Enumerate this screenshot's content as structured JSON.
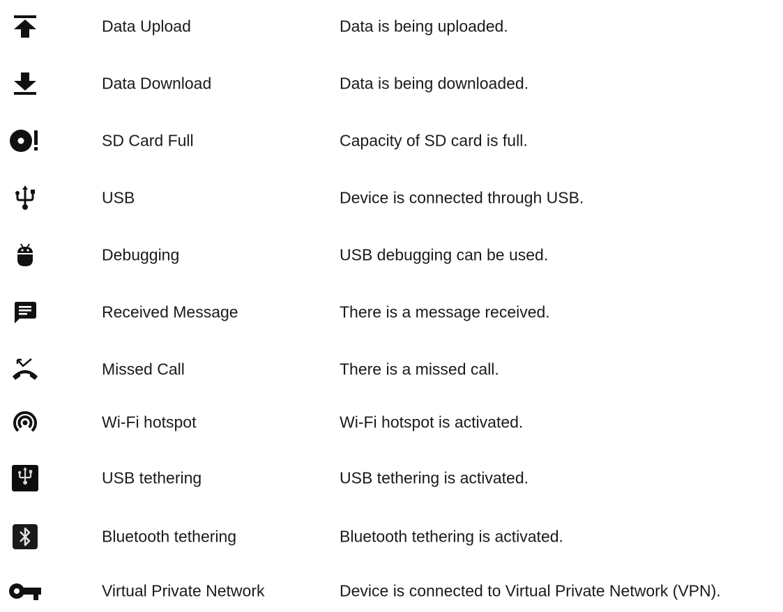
{
  "rows": [
    {
      "icon": "data-upload-icon",
      "name": "Data Upload",
      "description": "Data is being uploaded."
    },
    {
      "icon": "data-download-icon",
      "name": "Data Download",
      "description": "Data is being downloaded."
    },
    {
      "icon": "sd-card-full-icon",
      "name": "SD Card Full",
      "description": "Capacity of SD card is full."
    },
    {
      "icon": "usb-icon",
      "name": "USB",
      "description": "Device is connected through USB."
    },
    {
      "icon": "debugging-icon",
      "name": "Debugging",
      "description": "USB debugging can be used."
    },
    {
      "icon": "message-icon",
      "name": "Received Message",
      "description": "There is a message received."
    },
    {
      "icon": "missed-call-icon",
      "name": "Missed Call",
      "description": "There is a missed call."
    },
    {
      "icon": "wifi-hotspot-icon",
      "name": "Wi-Fi hotspot",
      "description": "Wi-Fi hotspot is activated."
    },
    {
      "icon": "usb-tethering-icon",
      "name": "USB tethering",
      "description": "USB tethering is activated."
    },
    {
      "icon": "bluetooth-tethering-icon",
      "name": "Bluetooth tethering",
      "description": "Bluetooth tethering is activated."
    },
    {
      "icon": "vpn-key-icon",
      "name": "Virtual Private Network",
      "description": "Device is connected to Virtual Private Network (VPN)."
    }
  ]
}
